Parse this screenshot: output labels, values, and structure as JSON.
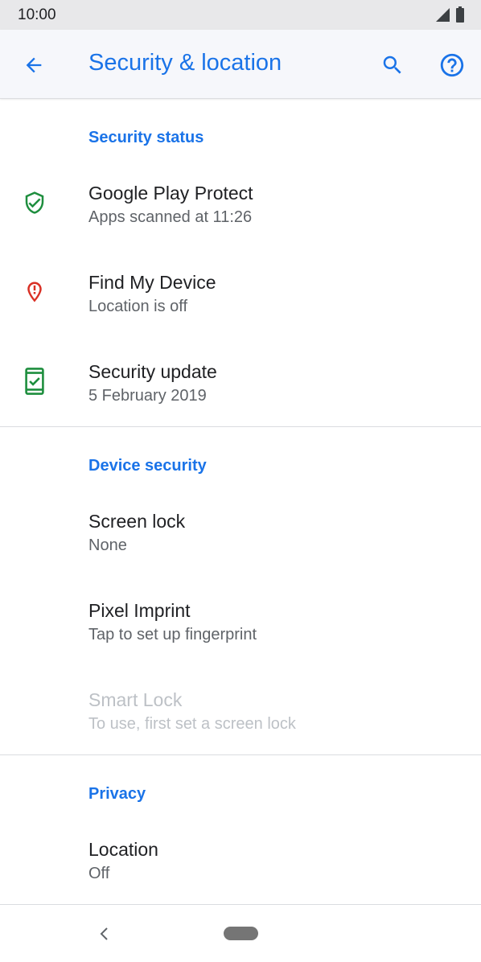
{
  "status_bar": {
    "time": "10:00",
    "icons": [
      "signal-icon",
      "battery-icon"
    ]
  },
  "app_bar": {
    "title": "Security & location",
    "icons": [
      "back-arrow-icon",
      "search-icon",
      "help-icon"
    ]
  },
  "sections": [
    {
      "header": "Security status",
      "items": [
        {
          "title": "Google Play Protect",
          "summary": "Apps scanned at 11:26",
          "icon": "shield-check-icon",
          "icon_color": "#1e8e3e"
        },
        {
          "title": "Find My Device",
          "summary": "Location is off",
          "icon": "location-alert-icon",
          "icon_color": "#d93025"
        },
        {
          "title": "Security update",
          "summary": "5 February 2019",
          "icon": "phone-check-icon",
          "icon_color": "#1e8e3e"
        }
      ]
    },
    {
      "header": "Device security",
      "items": [
        {
          "title": "Screen lock",
          "summary": "None"
        },
        {
          "title": "Pixel Imprint",
          "summary": "Tap to set up fingerprint"
        },
        {
          "title": "Smart Lock",
          "summary": "To use, first set a screen lock",
          "disabled": true
        }
      ]
    },
    {
      "header": "Privacy",
      "items": [
        {
          "title": "Location",
          "summary": "Off"
        }
      ]
    }
  ],
  "nav_bar": {
    "icons": [
      "nav-back-icon",
      "home-pill-icon"
    ]
  },
  "colors": {
    "accent": "#1a73e8",
    "disabled_text": "#bdc1c6"
  }
}
